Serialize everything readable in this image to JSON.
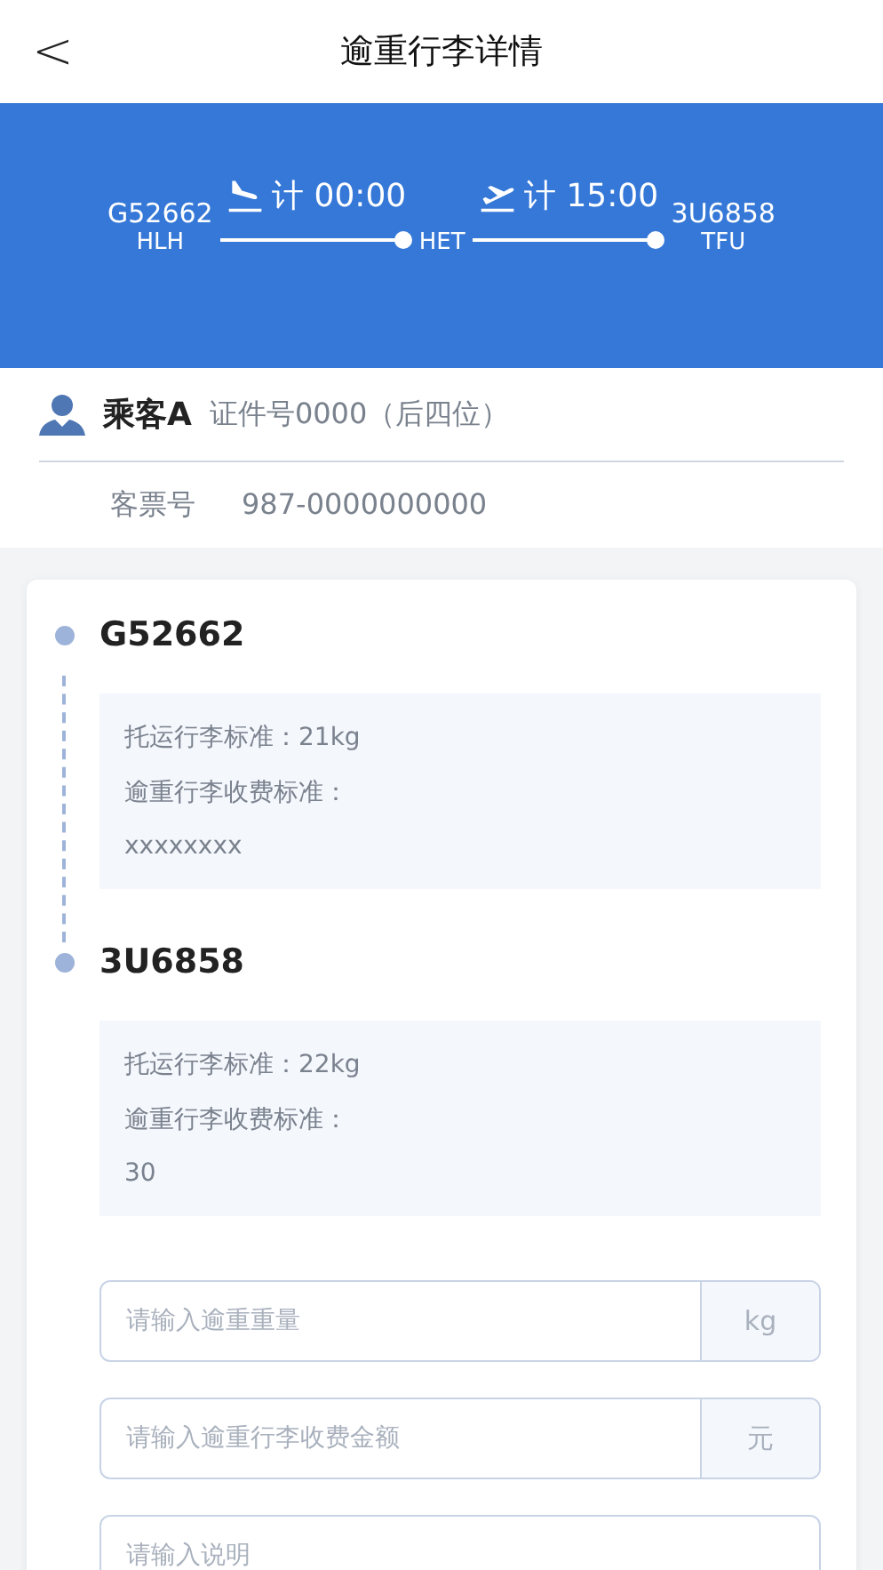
{
  "header": {
    "back": "<",
    "title": "逾重行李详情"
  },
  "flight_banner": {
    "origin_flight": "G52662",
    "origin_code": "HLH",
    "departure_time": "计 00:00",
    "transfer_code": "HET",
    "arrival_time": "计 15:00",
    "destination_flight": "3U6858",
    "destination_code": "TFU"
  },
  "passenger": {
    "name": "乘客A",
    "id_text": "证件号0000（后四位）",
    "ticket_label": "客票号",
    "ticket_number": "987-0000000000"
  },
  "segments": [
    {
      "flight": "G52662",
      "lines": [
        "托运行李标准：21kg",
        "逾重行李收费标准：",
        "xxxxxxxx"
      ]
    },
    {
      "flight": "3U6858",
      "lines": [
        "托运行李标准：22kg",
        "逾重行李收费标准：",
        "30"
      ]
    }
  ],
  "fields": [
    {
      "placeholder": "请输入逾重重量",
      "unit": "kg"
    },
    {
      "placeholder": "请输入逾重行李收费金额",
      "unit": "元"
    },
    {
      "placeholder": "请输入说明"
    }
  ]
}
